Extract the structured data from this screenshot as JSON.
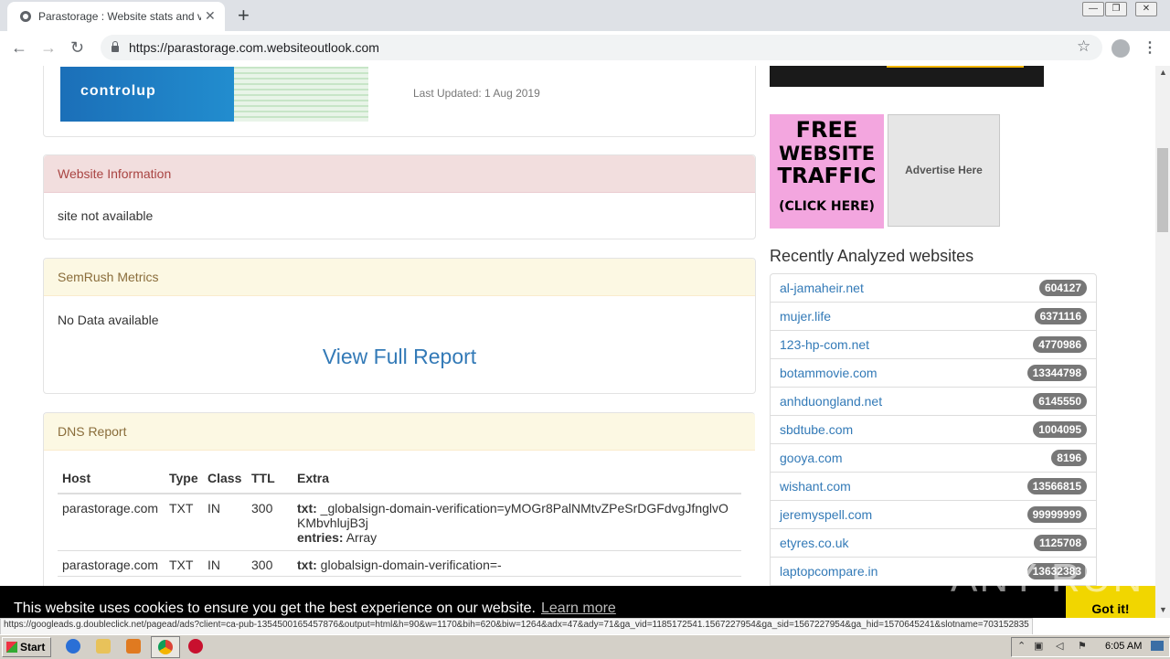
{
  "browser": {
    "tab_title": "Parastorage : Website stats and valuation",
    "url": "https://parastorage.com.websiteoutlook.com",
    "status_url": "https://googleads.g.doubleclick.net/pagead/ads?client=ca-pub-1354500165457876&output=html&h=90&w=1170&bih=620&biw=1264&adx=47&ady=71&ga_vid=1185172541.1567227954&ga_sid=1567227954&ga_hid=1570645241&slotname=703152835"
  },
  "banner": {
    "logo_text": "controlup",
    "last_updated": "Last Updated: 1 Aug 2019"
  },
  "website_info": {
    "heading": "Website Information",
    "body": "site not available"
  },
  "semrush": {
    "heading": "SemRush Metrics",
    "body": "No Data available",
    "report_link": "View Full Report"
  },
  "dns": {
    "heading": "DNS Report",
    "columns": [
      "Host",
      "Type",
      "Class",
      "TTL",
      "Extra"
    ],
    "rows": [
      {
        "host": "parastorage.com",
        "type": "TXT",
        "class": "IN",
        "ttl": "300",
        "txt_label": "txt:",
        "txt_value": "_globalsign-domain-verification=yMOGr8PalNMtvZPeSrDGFdvgJfnglvOKMbvhlujB3j",
        "entries_label": "entries:",
        "entries_value": "Array"
      },
      {
        "host": "parastorage.com",
        "type": "TXT",
        "class": "IN",
        "ttl": "300",
        "txt_label": "txt:",
        "txt_value": "globalsign-domain-verification=-"
      }
    ]
  },
  "sidebar": {
    "ad_free_traffic": [
      "FREE",
      "WEBSITE",
      "TRAFFIC",
      "(CLICK HERE)"
    ],
    "advertise_label": "Advertise Here",
    "recent_title": "Recently Analyzed websites",
    "recent": [
      {
        "site": "al-jamaheir.net",
        "rank": "604127"
      },
      {
        "site": "mujer.life",
        "rank": "6371116"
      },
      {
        "site": "123-hp-com.net",
        "rank": "4770986"
      },
      {
        "site": "botammovie.com",
        "rank": "13344798"
      },
      {
        "site": "anhduongland.net",
        "rank": "6145550"
      },
      {
        "site": "sbdtube.com",
        "rank": "1004095"
      },
      {
        "site": "gooya.com",
        "rank": "8196"
      },
      {
        "site": "wishant.com",
        "rank": "13566815"
      },
      {
        "site": "jeremyspell.com",
        "rank": "99999999"
      },
      {
        "site": "etyres.co.uk",
        "rank": "1125708"
      },
      {
        "site": "laptopcompare.in",
        "rank": "13632383"
      }
    ]
  },
  "cookie": {
    "text": "This website uses cookies to ensure you get the best experience on our website.",
    "link": "Learn more",
    "button": "Got it!"
  },
  "watermark": "ANY RUN",
  "taskbar": {
    "start": "Start",
    "clock": "6:05 AM"
  }
}
